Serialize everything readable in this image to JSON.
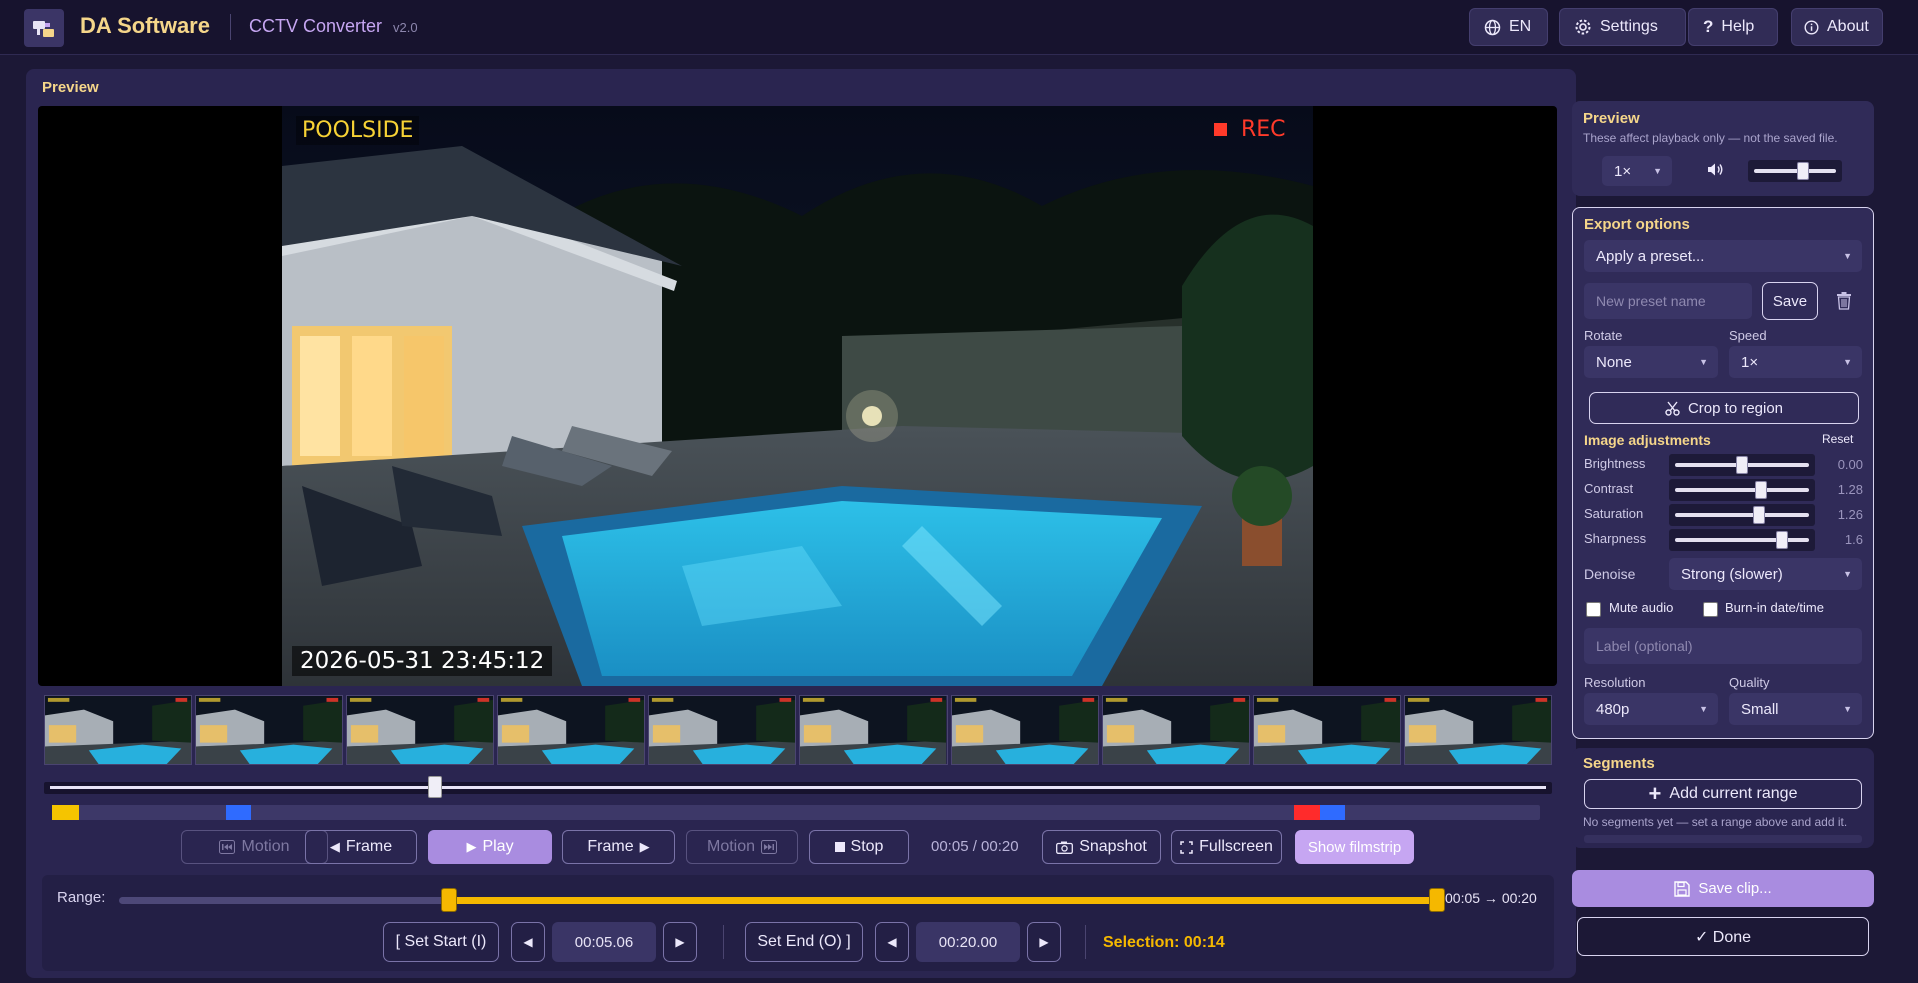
{
  "header": {
    "brand": "DA Software",
    "app_title": "CCTV Converter",
    "version": "v2.0",
    "buttons": {
      "language": "EN",
      "settings": "Settings",
      "help": "Help",
      "about": "About"
    }
  },
  "preview": {
    "heading": "Preview",
    "osd": {
      "camera": "POOLSIDE",
      "rec": "REC",
      "timestamp": "2026-05-31 23:45:12"
    },
    "filmstrip": {
      "thumb_count": 10
    },
    "seek_position": 0.255,
    "markers": [
      {
        "color": "#f5c400",
        "start": 0.0,
        "end": 0.018
      },
      {
        "color": "#2f6bff",
        "start": 0.117,
        "end": 0.134
      },
      {
        "color": "#ff2b2b",
        "start": 0.835,
        "end": 0.852
      },
      {
        "color": "#2f6bff",
        "start": 0.852,
        "end": 0.869
      }
    ]
  },
  "transport": {
    "motion_prev": "Motion",
    "frame_prev": "Frame",
    "play": "Play",
    "frame_next": "Frame",
    "motion_next": "Motion",
    "stop": "Stop",
    "time": "00:05 / 00:20",
    "snapshot": "Snapshot",
    "fullscreen": "Fullscreen",
    "filmstrip": "Show filmstrip"
  },
  "range": {
    "label": "Range:",
    "start_fraction": 0.25,
    "end_fraction": 1.0,
    "readout": "00:05 → 00:20",
    "set_start": "[ Set Start (I)",
    "start_value": "00:05.06",
    "set_end": "Set End (O) ]",
    "end_value": "00:20.00",
    "selection": "Selection: 00:14"
  },
  "playback": {
    "title": "Preview",
    "hint": "These affect playback only — not the saved file.",
    "speed": "1×",
    "volume": 0.6
  },
  "export": {
    "title": "Export options",
    "preset_select": "Apply a preset...",
    "preset_placeholder": "New preset name",
    "save": "Save",
    "rotate_label": "Rotate",
    "rotate_value": "None",
    "speed_label": "Speed",
    "speed_value": "1×",
    "crop": "Crop to region",
    "adjust_title": "Image adjustments",
    "reset": "Reset",
    "adjustments": [
      {
        "label": "Brightness",
        "value": "0.00",
        "fraction": 0.5
      },
      {
        "label": "Contrast",
        "value": "1.28",
        "fraction": 0.64
      },
      {
        "label": "Saturation",
        "value": "1.26",
        "fraction": 0.63
      },
      {
        "label": "Sharpness",
        "value": "1.6",
        "fraction": 0.8
      }
    ],
    "denoise_label": "Denoise",
    "denoise_value": "Strong (slower)",
    "mute_audio": "Mute audio",
    "burn_in": "Burn-in date/time",
    "label_placeholder": "Label (optional)",
    "resolution_label": "Resolution",
    "resolution_value": "480p",
    "quality_label": "Quality",
    "quality_value": "Small"
  },
  "segments": {
    "title": "Segments",
    "add": "Add current range",
    "hint": "No segments yet — set a range above and add it."
  },
  "actions": {
    "save_clip": "Save clip...",
    "done": "✓ Done"
  },
  "colors": {
    "accent": "#c6a6f2",
    "brand": "#f5d68a",
    "range": "#f5b800"
  }
}
